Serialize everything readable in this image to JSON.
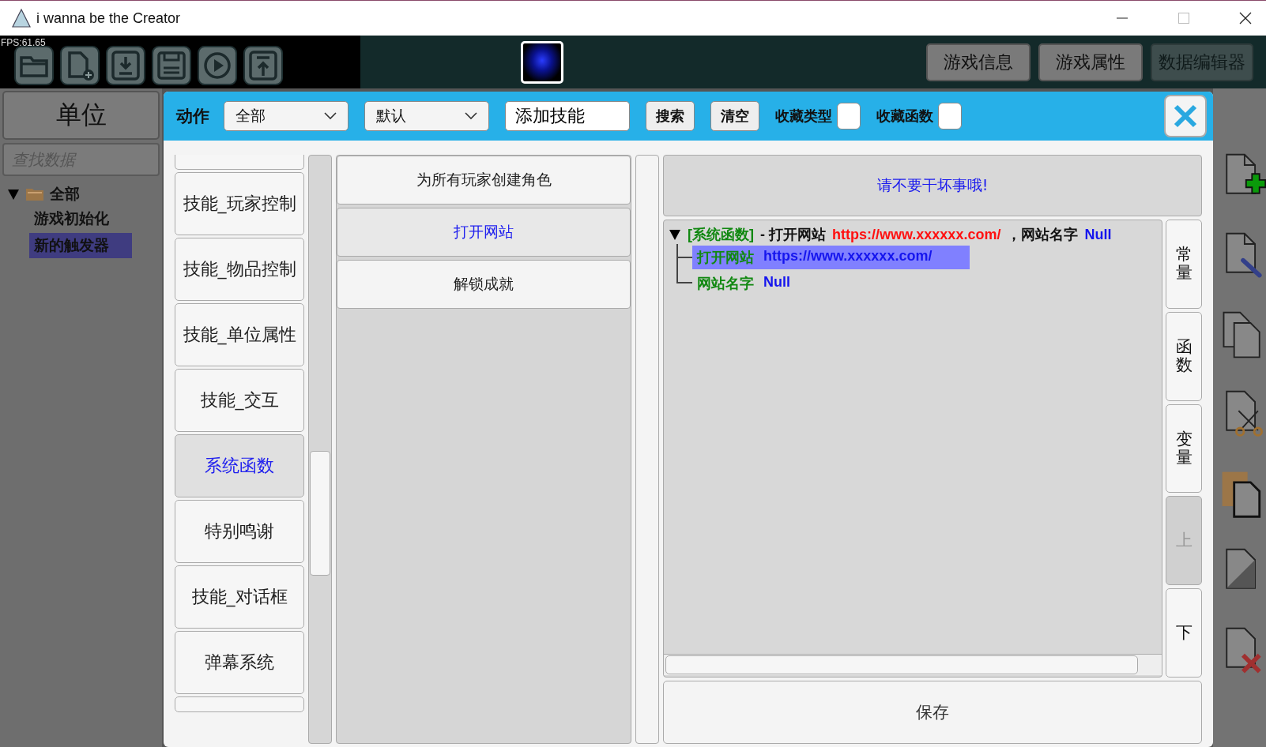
{
  "window": {
    "title": "i wanna be the Creator"
  },
  "toolbar": {
    "fps": "FPS:61.65",
    "buttons": [
      {
        "label": "游戏信息",
        "selected": false
      },
      {
        "label": "游戏属性",
        "selected": false
      },
      {
        "label": "数据编辑器",
        "selected": true
      }
    ]
  },
  "left_panel": {
    "header": "单位",
    "search": {
      "placeholder": "查找数据"
    },
    "tree": [
      {
        "label": "全部",
        "expanded": true,
        "children": [
          {
            "label": "游戏初始化",
            "selected": false
          },
          {
            "label": "新的触发器",
            "selected": true
          }
        ]
      }
    ]
  },
  "dialog": {
    "title": "动作",
    "filters": [
      {
        "kind": "dropdown",
        "value": "全部"
      },
      {
        "kind": "dropdown",
        "value": "默认"
      },
      {
        "kind": "input",
        "value": "添加技能"
      }
    ],
    "buttons": [
      "搜索",
      "清空"
    ],
    "toggles": [
      {
        "label": "收藏类型",
        "checked": false
      },
      {
        "label": "收藏函数",
        "checked": false
      }
    ],
    "categories": [
      {
        "label": "技能_玩家控制",
        "selected": false
      },
      {
        "label": "技能_物品控制",
        "selected": false
      },
      {
        "label": "技能_单位属性",
        "selected": false
      },
      {
        "label": "技能_交互",
        "selected": false
      },
      {
        "label": "系统函数",
        "selected": true
      },
      {
        "label": "特别鸣谢",
        "selected": false
      },
      {
        "label": "技能_对话框",
        "selected": false
      },
      {
        "label": "弹幕系统",
        "selected": false
      }
    ],
    "actions": [
      {
        "label": "为所有玩家创建角色",
        "selected": false
      },
      {
        "label": "打开网站",
        "selected": true
      },
      {
        "label": "解锁成就",
        "selected": false
      }
    ],
    "notice": "请不要干坏事哦!",
    "tree": {
      "expanded": true,
      "parts": [
        {
          "kind": "tag",
          "text": "[系统函数]"
        },
        {
          "kind": "plain",
          "text": "- 打开网站"
        },
        {
          "kind": "set",
          "text": "https://www.xxxxxx.com/"
        },
        {
          "kind": "plain",
          "text": "，网站名字"
        },
        {
          "kind": "unset",
          "text": "Null"
        }
      ],
      "children": [
        {
          "name": "打开网站",
          "value": "https://www.xxxxxx.com/",
          "selected": true
        },
        {
          "name": "网站名字",
          "value": "Null",
          "selected": false
        }
      ]
    },
    "side_buttons": [
      {
        "label": "常量",
        "disabled": false
      },
      {
        "label": "函数",
        "disabled": false
      },
      {
        "label": "变量",
        "disabled": false
      },
      {
        "label": "上",
        "disabled": true
      },
      {
        "label": "下",
        "disabled": false
      }
    ],
    "save": "保存"
  }
}
